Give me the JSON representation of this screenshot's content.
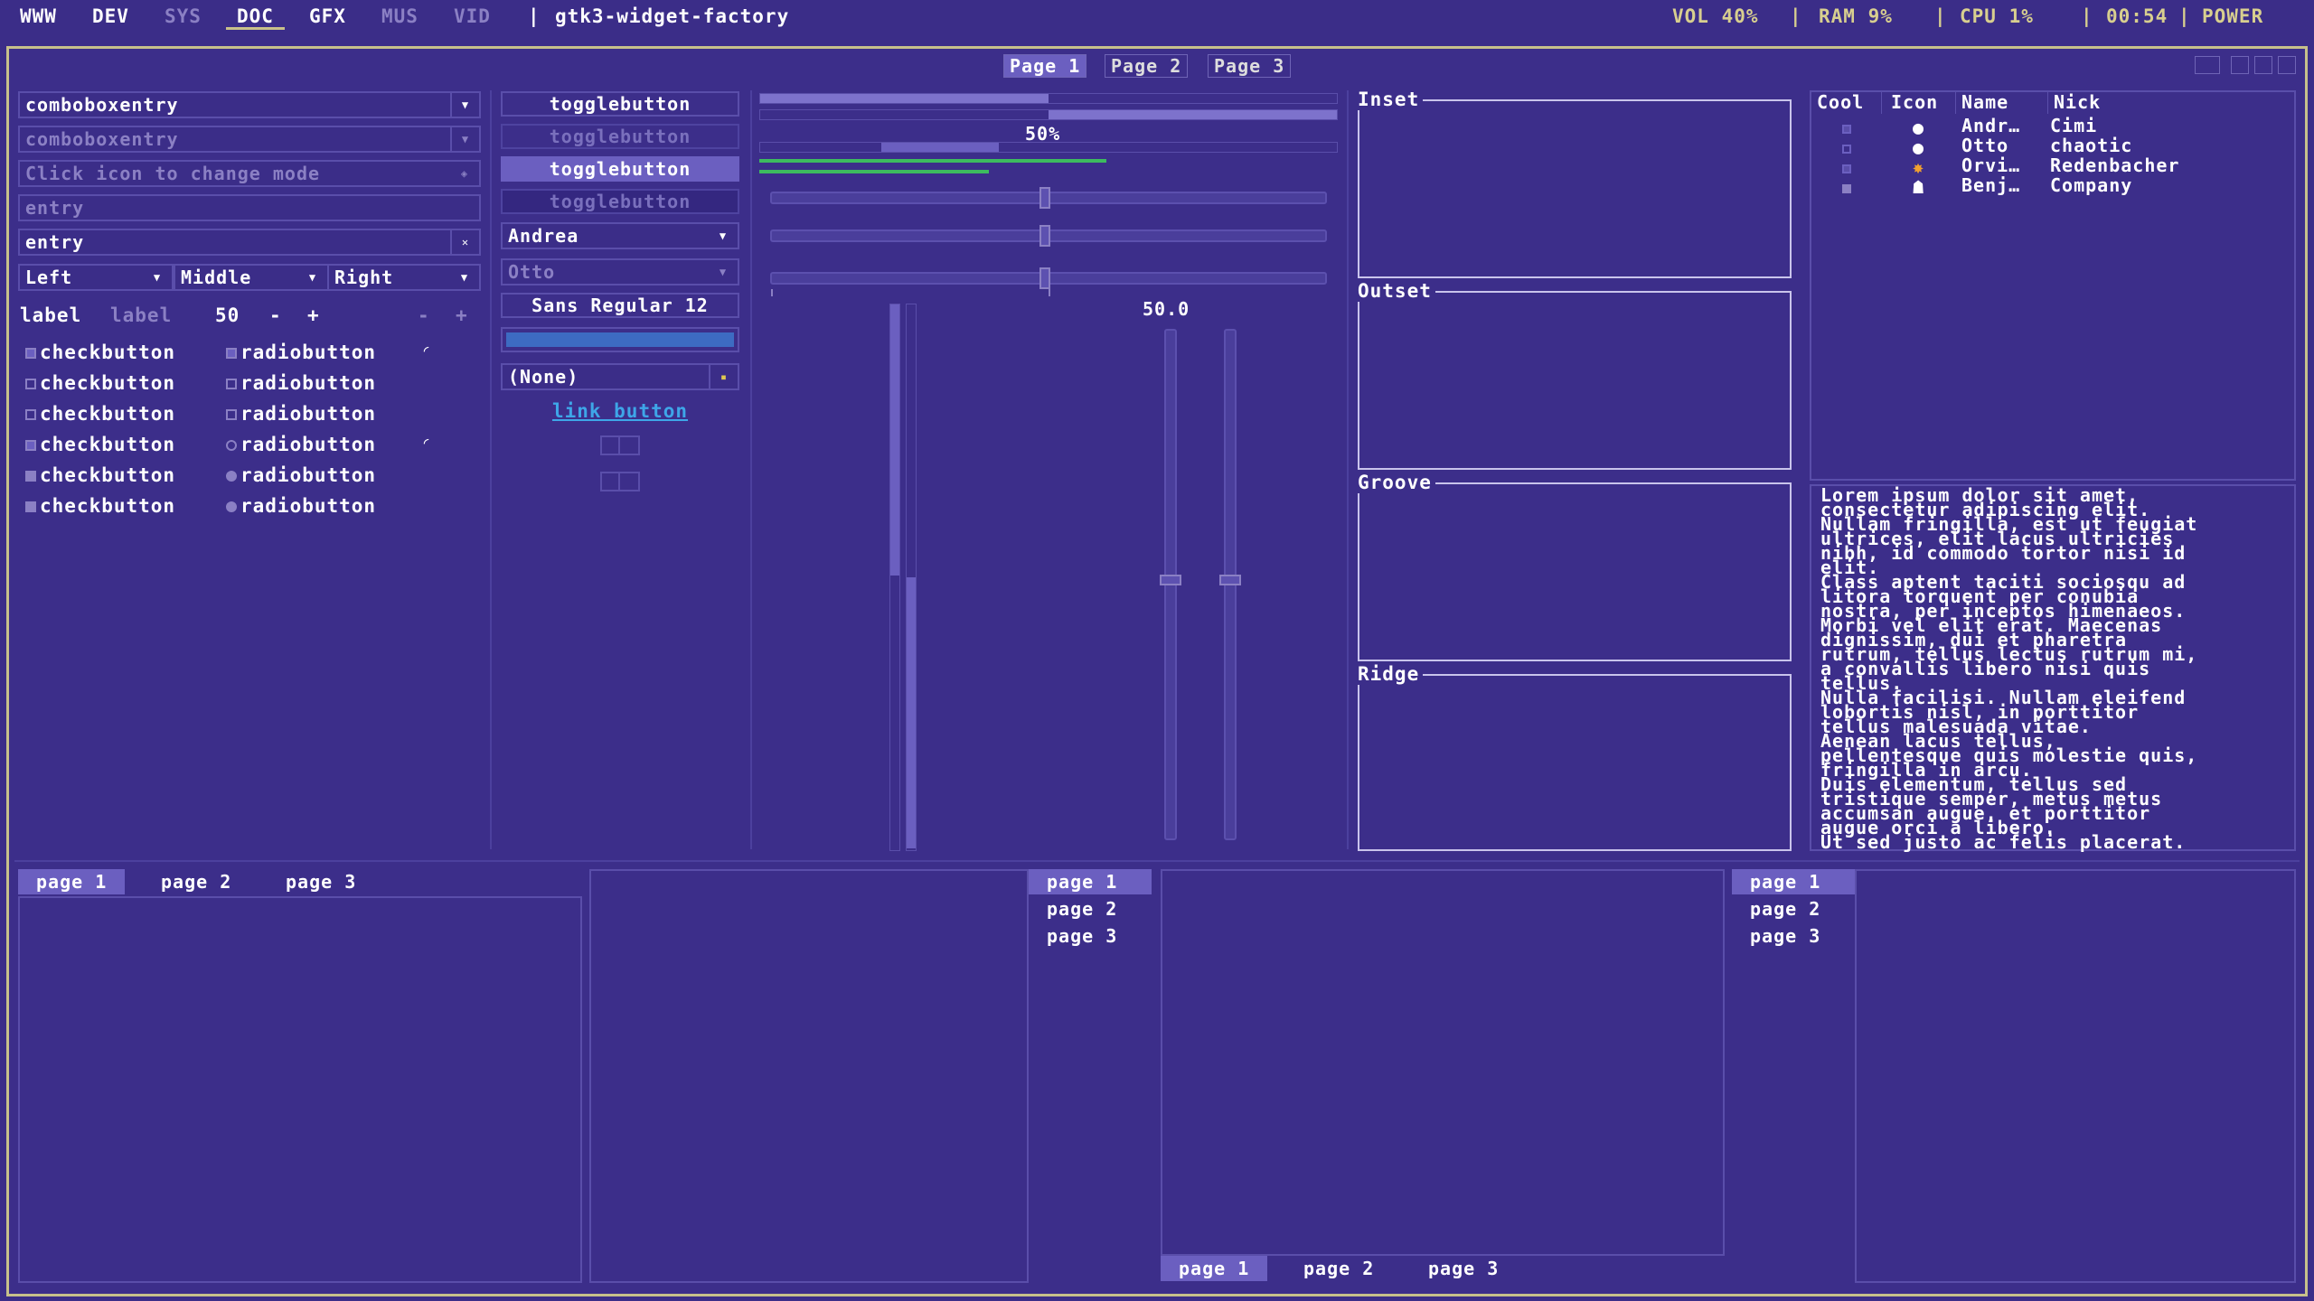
{
  "topbar": {
    "workspaces": [
      "WWW",
      "DEV",
      "SYS",
      "DOC",
      "GFX",
      "MUS",
      "VID"
    ],
    "window_title": "gtk3-widget-factory",
    "vol": "VOL 40%",
    "ram": "RAM 9%",
    "cpu": "CPU 1%",
    "time": "00:54",
    "power": "POWER",
    "sep": "|"
  },
  "notebook_tabs": [
    "Page 1",
    "Page 2",
    "Page 3"
  ],
  "left": {
    "combo1": "comboboxentry",
    "combo2": "comboboxentry",
    "entry_mode": "Click icon to change mode",
    "entry_placeholder": "entry",
    "entry_value": "entry",
    "seg": [
      "Left",
      "Middle",
      "Right"
    ],
    "label1": "label",
    "label2": "label",
    "spin_value": "50",
    "minus": "-",
    "plus": "+",
    "checks": [
      "checkbutton",
      "checkbutton",
      "checkbutton",
      "checkbutton",
      "checkbutton",
      "checkbutton"
    ],
    "radios": [
      "radiobutton",
      "radiobutton",
      "radiobutton",
      "radiobutton",
      "radiobutton",
      "radiobutton"
    ]
  },
  "middle": {
    "toggles": [
      "togglebutton",
      "togglebutton",
      "togglebutton",
      "togglebutton"
    ],
    "combo_andrea": "Andrea",
    "combo_otto": "Otto",
    "font_button": "Sans Regular",
    "font_size": "12",
    "file_none": "(None)",
    "link": "link button"
  },
  "progress": {
    "percent_label": "50%",
    "scale_value": "50.0",
    "fraction": 0.5
  },
  "frames": [
    "Inset",
    "Outset",
    "Groove",
    "Ridge"
  ],
  "tree": {
    "headers": [
      "Cool",
      "Icon",
      "Name",
      "Nick"
    ],
    "rows": [
      {
        "name": "Andr…",
        "nick": "Cimi"
      },
      {
        "name": "Otto",
        "nick": "chaotic"
      },
      {
        "name": "Orvi…",
        "nick": "Redenbacher"
      },
      {
        "name": "Benj…",
        "nick": "Company"
      }
    ]
  },
  "lorem": "Lorem ipsum dolor sit amet,\nconsectetur adipiscing elit.\nNullam fringilla, est ut feugiat\nultrices, elit lacus ultricies\nnibh, id commodo tortor nisi id\nelit.\nClass aptent taciti sociosqu ad\nlitora torquent per conubia\nnostra, per inceptos himenaeos.\nMorbi vel elit erat. Maecenas\ndignissim, dui et pharetra\nrutrum, tellus lectus rutrum mi,\na convallis libero nisi quis\ntellus.\nNulla facilisi. Nullam eleifend\nlobortis nisl, in porttitor\ntellus malesuada vitae.\nAenean lacus tellus,\npellentesque quis molestie quis,\nfringilla in arcu.\nDuis elementum, tellus sed\ntristique semper, metus metus\naccumsan augue, et porttitor\naugue orci a libero.\nUt sed justo ac felis placerat.",
  "bottom_tabs": [
    "page 1",
    "page 2",
    "page 3"
  ]
}
